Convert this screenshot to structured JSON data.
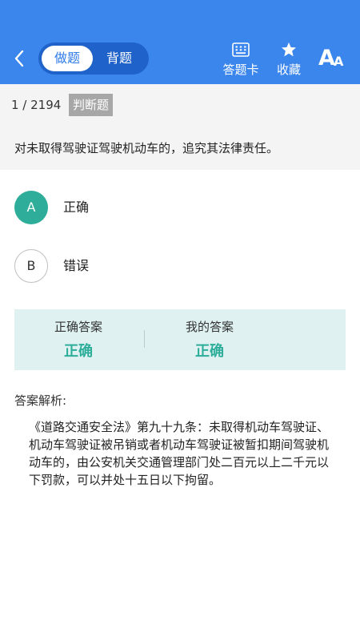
{
  "header": {
    "tabs": [
      {
        "label": "做题"
      },
      {
        "label": "背题"
      }
    ],
    "answer_card_label": "答题卡",
    "favorite_label": "收藏",
    "font_size_glyph_big": "A",
    "font_size_glyph_small": "A",
    "bg_color": "#3b86ec"
  },
  "question": {
    "progress": "1 / 2194",
    "type": "判断题",
    "text": "对未取得驾驶证驾驶机动车的，追究其法律责任。"
  },
  "options": [
    {
      "letter": "A",
      "text": "正确",
      "selected": true
    },
    {
      "letter": "B",
      "text": "错误",
      "selected": false
    }
  ],
  "answer": {
    "correct_label": "正确答案",
    "correct_value": "正确",
    "mine_label": "我的答案",
    "mine_value": "正确",
    "accent_color": "#2eae9a"
  },
  "explanation": {
    "title": "答案解析:",
    "text": "《道路交通安全法》第九十九条：未取得机动车驾驶证、机动车驾驶证被吊销或者机动车驾驶证被暂扣期间驾驶机动车的，由公安机关交通管理部门处二百元以上二千元以下罚款，可以并处十五日以下拘留。"
  }
}
